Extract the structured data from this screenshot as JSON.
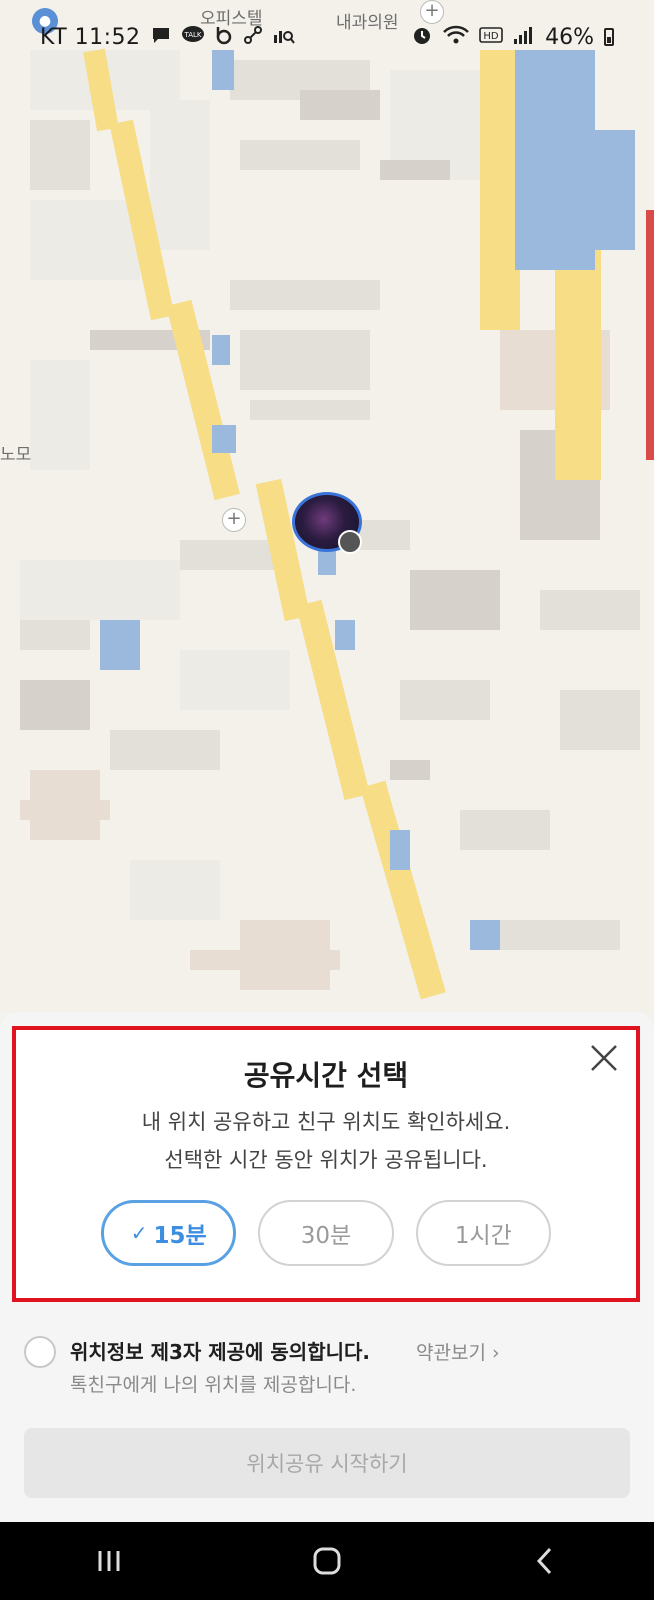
{
  "status_bar": {
    "carrier_time": "KT 11:52",
    "battery_percent": "46%",
    "icons": [
      "message-icon",
      "kakaotalk-icon",
      "b-app-icon",
      "link-icon",
      "search-chart-icon",
      "alarm-icon",
      "wifi-icon",
      "hd-icon",
      "signal-icon",
      "battery-icon"
    ]
  },
  "map": {
    "labels": [
      "오피스텔",
      "내과의원",
      "노모"
    ]
  },
  "dialog": {
    "title": "공유시간 선택",
    "description_line1": "내 위치 공유하고 친구 위치도 확인하세요.",
    "description_line2": "선택한 시간 동안 위치가 공유됩니다.",
    "options": [
      {
        "label": "15분",
        "selected": true
      },
      {
        "label": "30분",
        "selected": false
      },
      {
        "label": "1시간",
        "selected": false
      }
    ],
    "close_icon": "close-icon",
    "highlight_color": "#e0141e",
    "selected_color": "#3d8ee0"
  },
  "consent": {
    "main_text": "위치정보 제3자 제공에 동의합니다.",
    "terms_link": "약관보기",
    "sub_text": "톡친구에게 나의 위치를 제공합니다.",
    "checked": false
  },
  "start_button": {
    "label": "위치공유 시작하기",
    "enabled": false
  },
  "nav_bar": {
    "icons": [
      "recent-apps-icon",
      "home-icon",
      "back-icon"
    ]
  }
}
